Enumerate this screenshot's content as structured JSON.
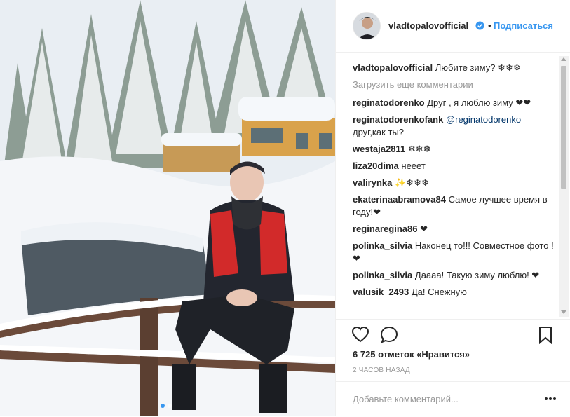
{
  "post": {
    "author": "vladtopalovofficial",
    "verified_icon": "verified-badge-icon",
    "separator": "•",
    "follow_label": "Подписаться",
    "caption_text": "Любите зиму? ❄❄❄",
    "load_more": "Загрузить еще комментарии",
    "comments": [
      {
        "user": "reginatodorenko",
        "text": "Друг , я люблю зиму ❤❤"
      },
      {
        "user": "reginatodorenkofank",
        "mention": "@reginatodorenko",
        "text": "друг,как ты?"
      },
      {
        "user": "westaja2811",
        "text": "❄❄❄"
      },
      {
        "user": "liza20dima",
        "text": "нееет"
      },
      {
        "user": "valirynka",
        "text": "✨❄❄❄"
      },
      {
        "user": "ekaterinaabramova84",
        "text": "Самое лучшее время в году!❤"
      },
      {
        "user": "reginaregina86",
        "text": "❤"
      },
      {
        "user": "polinka_silvia",
        "text": "Наконец то!!! Совместное фото ! ❤"
      },
      {
        "user": "polinka_silvia",
        "text": "Даааа! Такую зиму люблю! ❤"
      },
      {
        "user": "valusik_2493",
        "text": "Да! Снежную"
      }
    ],
    "likes_count": "6 725",
    "likes_text": "отметок «Нравится»",
    "time": "2 часов назад",
    "add_comment_placeholder": "Добавьте комментарий..."
  },
  "icons": {
    "like": "heart-icon",
    "comment": "comment-icon",
    "save": "bookmark-icon",
    "more": "more-options-icon"
  },
  "carousel": {
    "current": 1,
    "total": 2
  },
  "colors": {
    "accent": "#3897f0",
    "text": "#262626",
    "muted": "#999999"
  }
}
